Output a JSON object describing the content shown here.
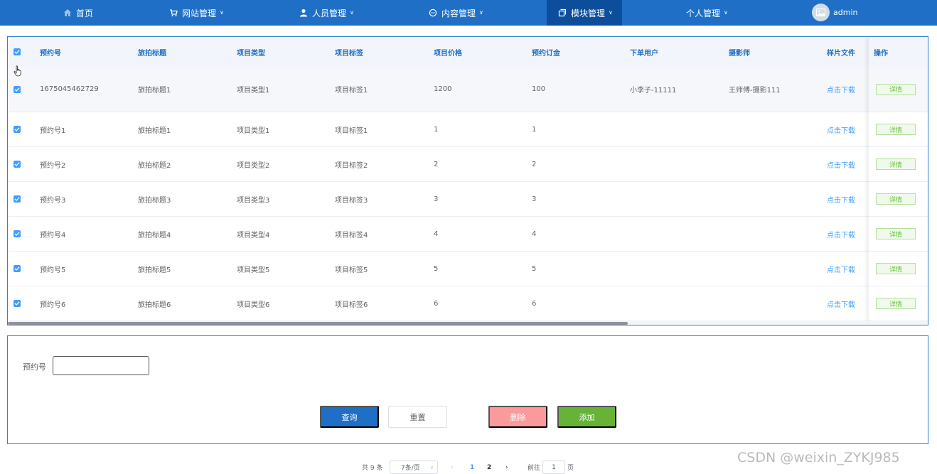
{
  "nav": {
    "items": [
      {
        "label": "首页",
        "icon": "home-icon"
      },
      {
        "label": "网站管理",
        "icon": "cart-icon"
      },
      {
        "label": "人员管理",
        "icon": "user-icon"
      },
      {
        "label": "内容管理",
        "icon": "chat-icon"
      },
      {
        "label": "模块管理",
        "icon": "copy-icon"
      },
      {
        "label": "个人管理",
        "icon": ""
      }
    ],
    "user": "admin",
    "colors": {
      "bar": "#1f6fc6",
      "active": "#0d4e9c"
    }
  },
  "table": {
    "columns": [
      "预约号",
      "旅拍标题",
      "项目类型",
      "项目标签",
      "项目价格",
      "预约订金",
      "下单用户",
      "摄影师",
      "样片文件",
      "操作"
    ],
    "rows": [
      {
        "no": "1675045462729",
        "title": "旅拍标题1",
        "type": "项目类型1",
        "tag": "项目标签1",
        "price": "1200",
        "deposit": "100",
        "user": "小李子-11111",
        "photographer": "王师傅-摄影111",
        "file": "点击下载",
        "action": "详情"
      },
      {
        "no": "预约号1",
        "title": "旅拍标题1",
        "type": "项目类型1",
        "tag": "项目标签1",
        "price": "1",
        "deposit": "1",
        "user": "",
        "photographer": "",
        "file": "点击下载",
        "action": "详情"
      },
      {
        "no": "预约号2",
        "title": "旅拍标题2",
        "type": "项目类型2",
        "tag": "项目标签2",
        "price": "2",
        "deposit": "2",
        "user": "",
        "photographer": "",
        "file": "点击下载",
        "action": "详情"
      },
      {
        "no": "预约号3",
        "title": "旅拍标题3",
        "type": "项目类型3",
        "tag": "项目标签3",
        "price": "3",
        "deposit": "3",
        "user": "",
        "photographer": "",
        "file": "点击下载",
        "action": "详情"
      },
      {
        "no": "预约号4",
        "title": "旅拍标题4",
        "type": "项目类型4",
        "tag": "项目标签4",
        "price": "4",
        "deposit": "4",
        "user": "",
        "photographer": "",
        "file": "点击下载",
        "action": "详情"
      },
      {
        "no": "预约号5",
        "title": "旅拍标题5",
        "type": "项目类型5",
        "tag": "项目标签5",
        "price": "5",
        "deposit": "5",
        "user": "",
        "photographer": "",
        "file": "点击下载",
        "action": "详情"
      },
      {
        "no": "预约号6",
        "title": "旅拍标题6",
        "type": "项目类型6",
        "tag": "项目标签6",
        "price": "6",
        "deposit": "6",
        "user": "",
        "photographer": "",
        "file": "点击下载",
        "action": "详情"
      }
    ]
  },
  "search": {
    "label": "预约号",
    "value": "",
    "buttons": {
      "query": "查询",
      "reset": "重置",
      "delete": "删除",
      "add": "添加"
    }
  },
  "pager": {
    "total": "共 9 条",
    "size": "7条/页",
    "pages": [
      "1",
      "2"
    ],
    "current": "1",
    "goto_prefix": "前往",
    "goto_value": "1",
    "goto_suffix": "页"
  },
  "watermark": "CSDN @weixin_ZYKJ985"
}
